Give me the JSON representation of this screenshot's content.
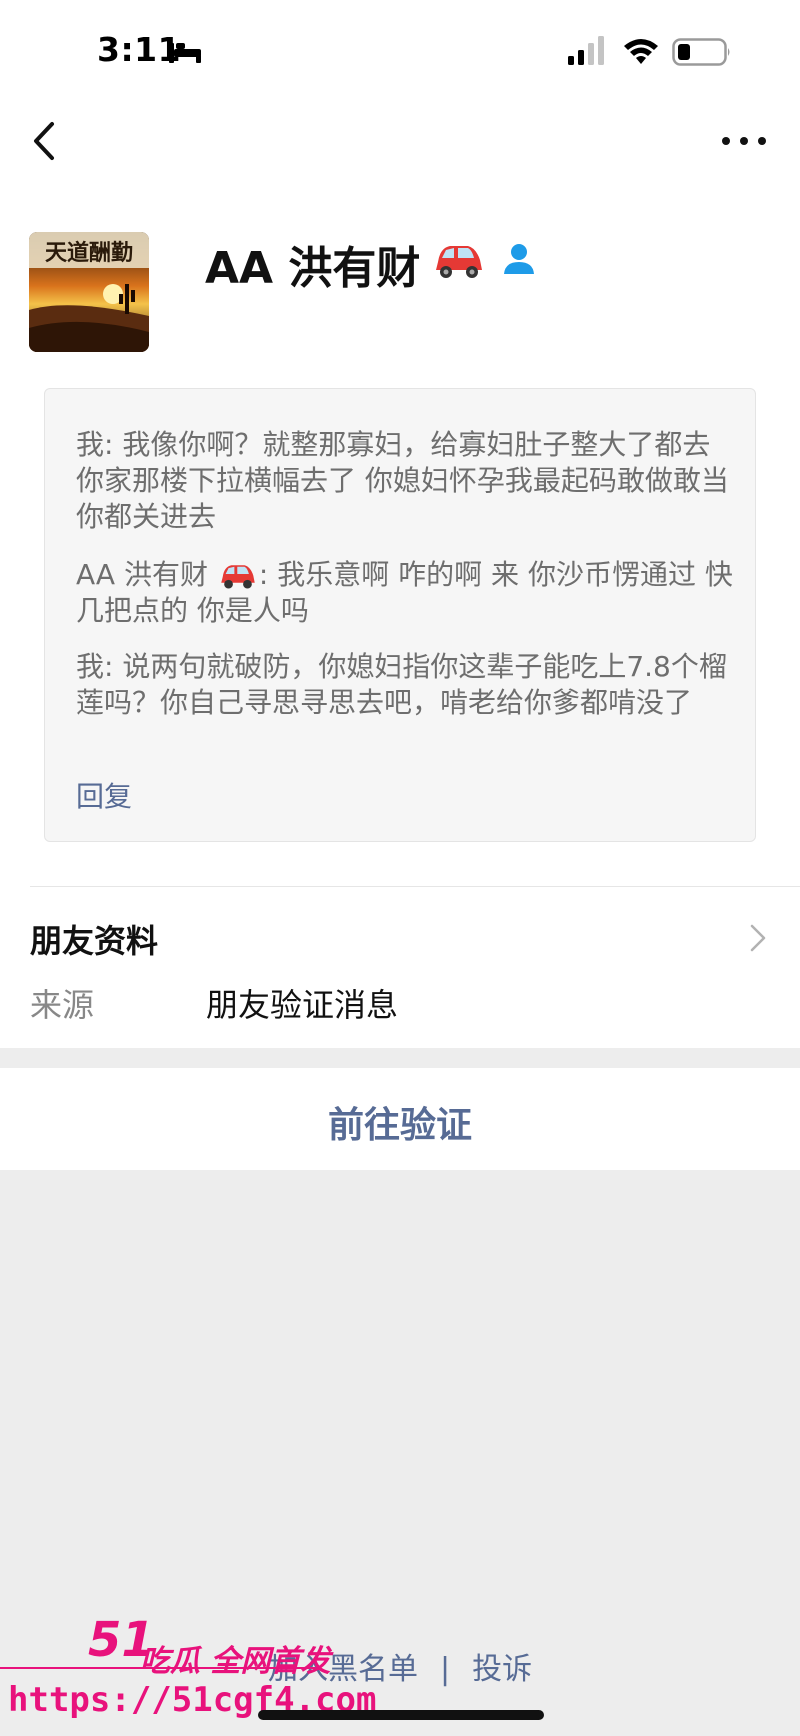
{
  "status_bar": {
    "time": "3:11",
    "icons": [
      "bed-icon",
      "signal-icon",
      "wifi-icon",
      "battery-icon"
    ]
  },
  "nav": {
    "back_icon": "chevron-left-icon",
    "more_icon": "more-horizontal-icon"
  },
  "profile": {
    "avatar_text": "天道酬勤",
    "name": "AA 洪有财",
    "name_emoji": "car-icon",
    "badge_icon": "person-icon"
  },
  "messages": [
    {
      "text": "我: 我像你啊？就整那寡妇，给寡妇肚子整大了都去你家那楼下拉横幅去了 你媳妇怀孕我最起码敢做敢当 你都关进去"
    },
    {
      "sender": "AA 洪有财",
      "text": ": 我乐意啊 咋的啊 来 你沙币愣通过 快几把点的 你是人吗"
    },
    {
      "text": "我: 说两句就破防，你媳妇指你这辈子能吃上7.8个榴莲吗？你自己寻思寻思去吧，啃老给你爹都啃没了"
    }
  ],
  "reply_label": "回复",
  "friend_info": {
    "title": "朋友资料",
    "source_label": "来源",
    "source_value": "朋友验证消息"
  },
  "verify_button": "前往验证",
  "footer": {
    "blacklist": "加入黑名单",
    "separator": "|",
    "report": "投诉"
  },
  "watermark": {
    "logo": "51",
    "text": "吃瓜 全网首发",
    "url": "https://51cgf4.com"
  },
  "colors": {
    "link": "#576b95",
    "background": "#ededed",
    "watermark": "#e8127c"
  }
}
